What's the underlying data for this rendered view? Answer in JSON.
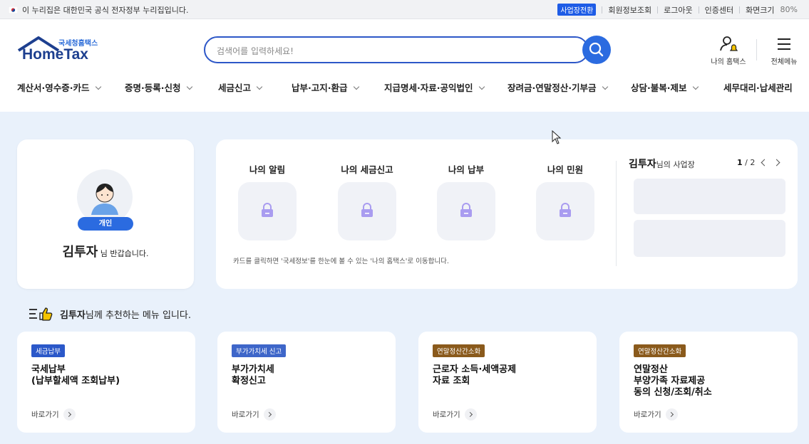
{
  "topbar": {
    "gov_notice": "이 누리집은 대한민국 공식 전자정부 누리집입니다.",
    "biz_switch": "사업장전환",
    "links": [
      "회원정보조회",
      "로그아웃",
      "인증센터"
    ],
    "zoom_label": "화면크기",
    "zoom_value": "80%"
  },
  "logo": {
    "sub": "국세청홈택스",
    "main": "HomeTax"
  },
  "search": {
    "placeholder": "검색어를 입력하세요!"
  },
  "header_actions": {
    "my_hometax": "나의 홈택스",
    "all_menu": "전체메뉴"
  },
  "nav": [
    "계산서·영수증·카드",
    "증명·등록·신청",
    "세금신고",
    "납부·고지·환급",
    "지급명세·자료·공익법인",
    "장려금·연말정산·기부금",
    "상담·불복·제보",
    "세무대리·납세관리"
  ],
  "profile": {
    "badge": "개인",
    "name": "김투자",
    "greeting": "님 반갑습니다."
  },
  "status": {
    "items": [
      "나의 알림",
      "나의 세금신고",
      "나의 납부",
      "나의 민원"
    ],
    "note": "카드를 클릭하면 '국세정보'를 한눈에 볼 수 있는 '나의 홈택스'로 이동합니다."
  },
  "biz": {
    "name": "김투자",
    "suffix": "님의 사업장",
    "page_current": "1",
    "page_total": "/ 2"
  },
  "recommend": {
    "name": "김투자",
    "suffix": "님께 추천하는 메뉴 입니다.",
    "go_label": "바로가기",
    "cards": [
      {
        "tag": "세금납부",
        "tag_color": "#2b58c9",
        "text": "국세납부\n(납부할세액 조회납부)"
      },
      {
        "tag": "부가가치세 신고",
        "tag_color": "#3e66c9",
        "text": "부가가치세\n확정신고"
      },
      {
        "tag": "연말정산간소화",
        "tag_color": "#8a5a1c",
        "text": "근로자 소득·세액공제\n자료 조회"
      },
      {
        "tag": "연말정산간소화",
        "tag_color": "#8a5a1c",
        "text": "연말정산\n부양가족 자료제공\n동의 신청/조회/취소"
      }
    ]
  }
}
